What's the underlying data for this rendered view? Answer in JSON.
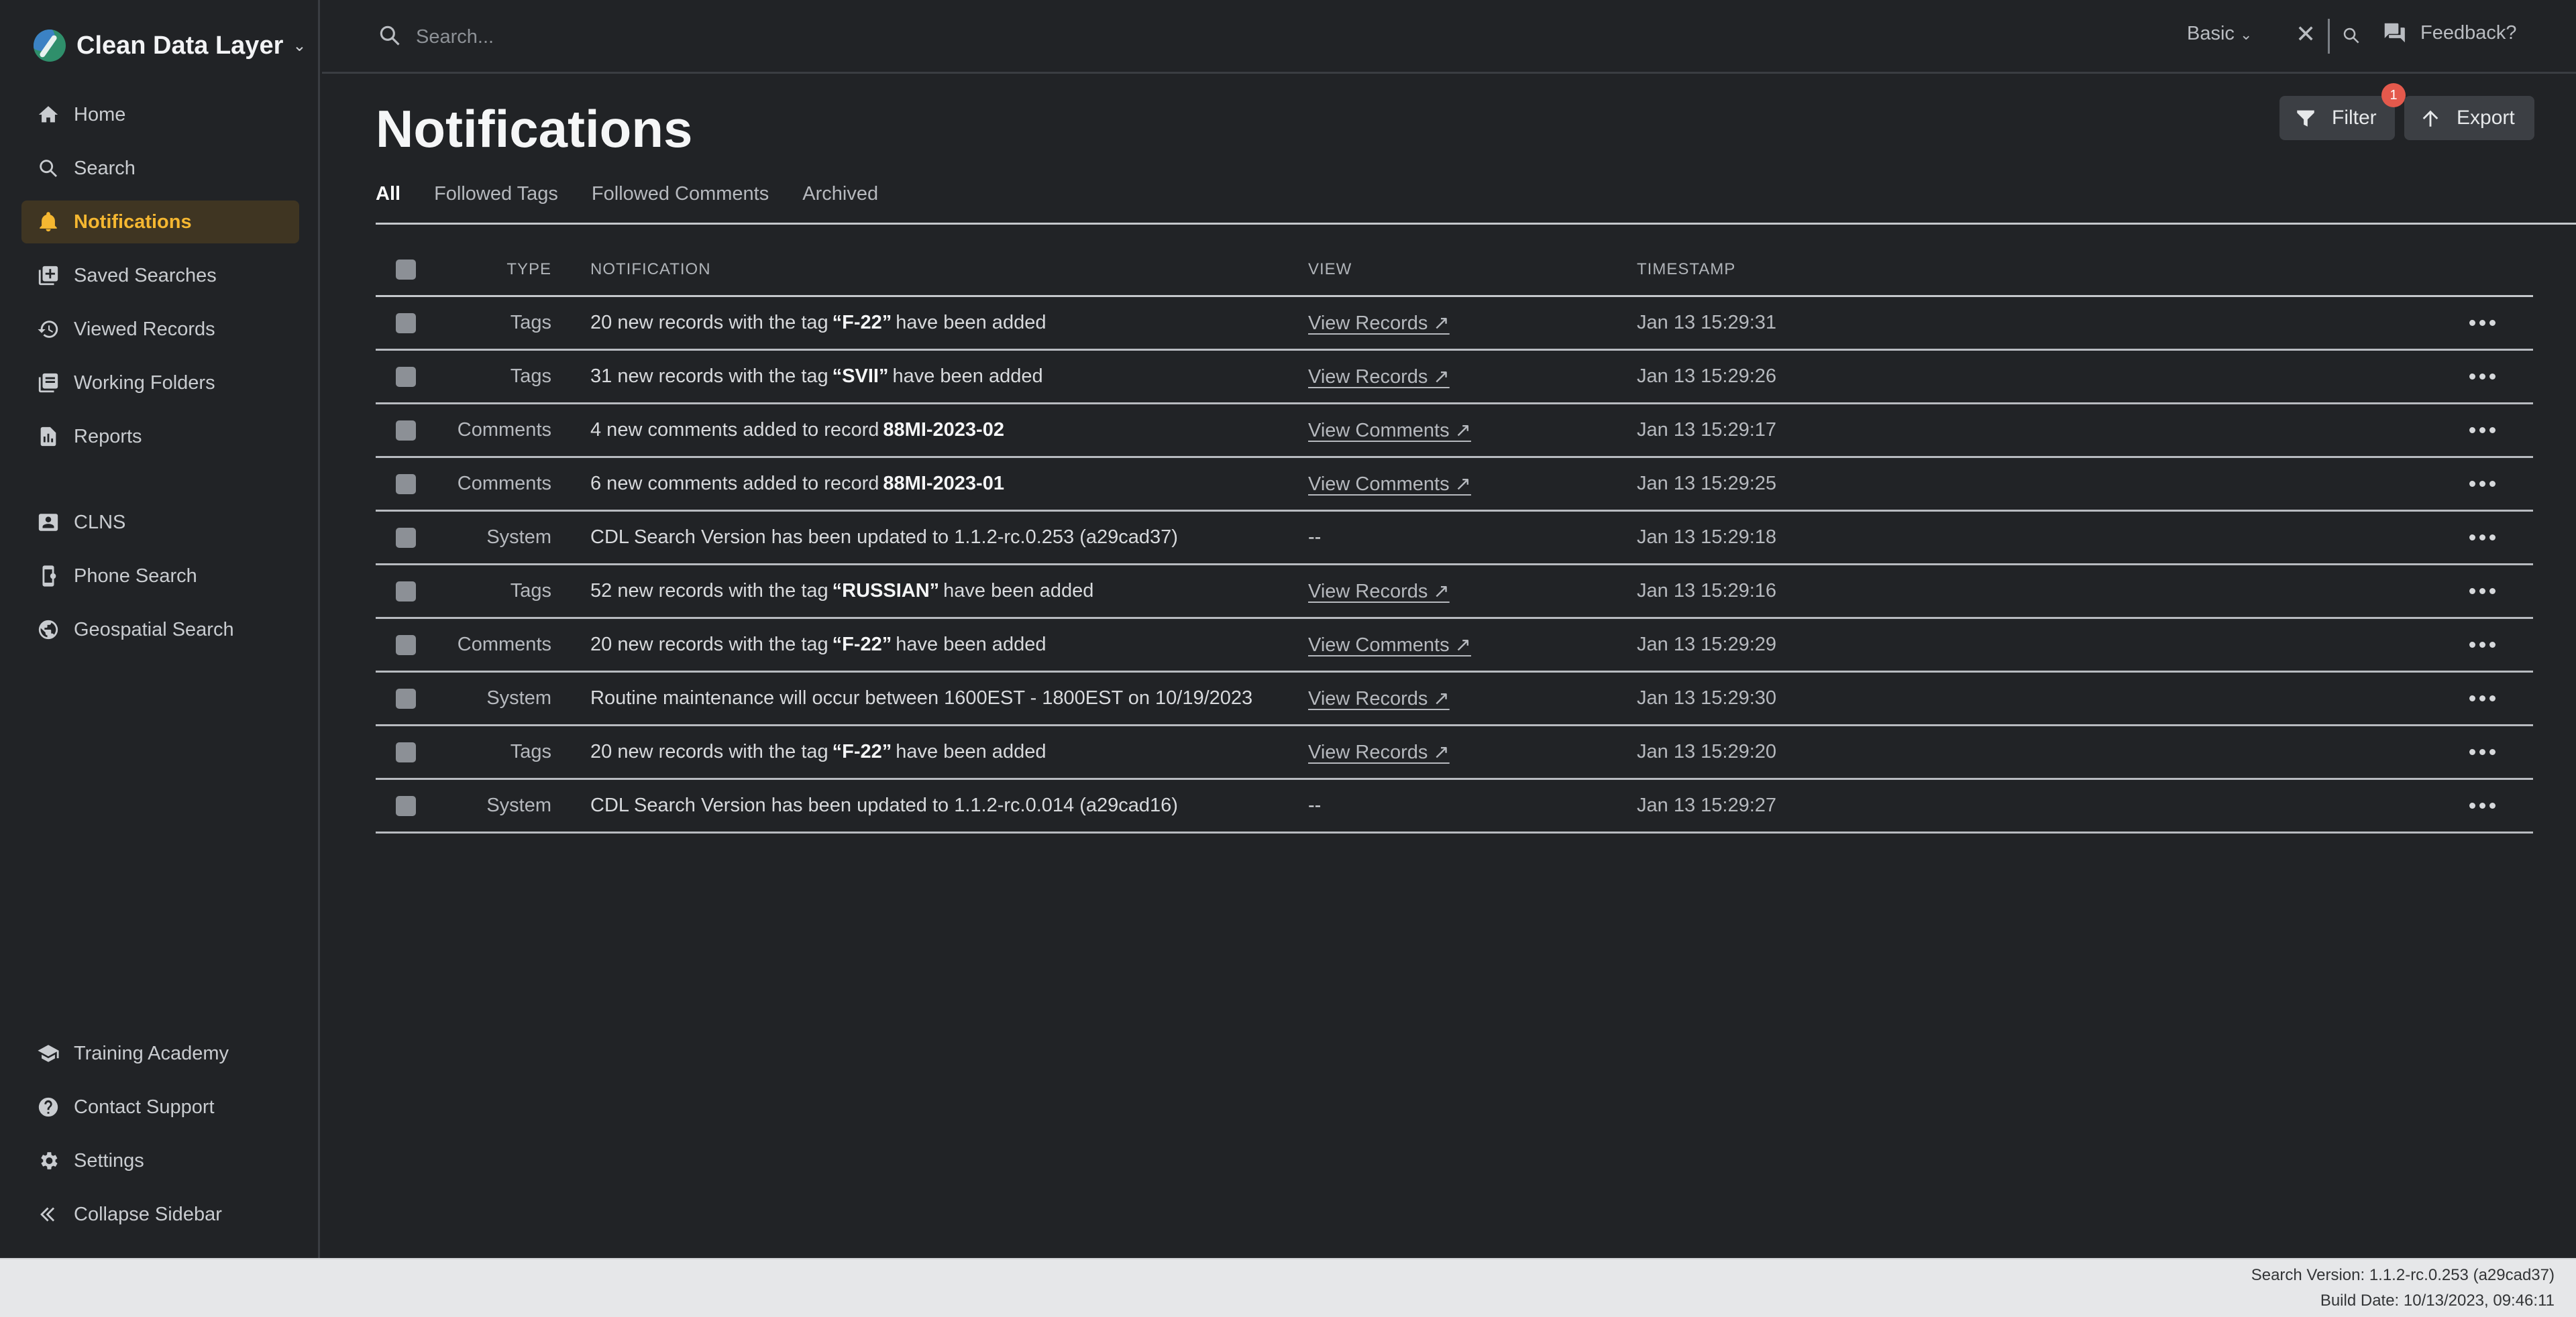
{
  "app": {
    "name": "Clean Data Layer"
  },
  "sidebar": {
    "items": [
      {
        "label": "Home",
        "icon": "home-icon"
      },
      {
        "label": "Search",
        "icon": "search-icon"
      },
      {
        "label": "Notifications",
        "icon": "bell-icon",
        "active": true
      },
      {
        "label": "Saved Searches",
        "icon": "saved-search-icon"
      },
      {
        "label": "Viewed Records",
        "icon": "history-icon"
      },
      {
        "label": "Working Folders",
        "icon": "folder-icon"
      },
      {
        "label": "Reports",
        "icon": "report-icon"
      },
      {
        "label": "CLNS",
        "icon": "contact-card-icon"
      },
      {
        "label": "Phone Search",
        "icon": "phone-icon"
      },
      {
        "label": "Geospatial Search",
        "icon": "globe-icon"
      }
    ],
    "bottom_items": [
      {
        "label": "Training Academy",
        "icon": "graduation-cap-icon"
      },
      {
        "label": "Contact Support",
        "icon": "help-icon"
      },
      {
        "label": "Settings",
        "icon": "gear-icon"
      },
      {
        "label": "Collapse Sidebar",
        "icon": "double-chevron-left-icon"
      }
    ]
  },
  "topbar": {
    "search_placeholder": "Search...",
    "mode": "Basic",
    "feedback": "Feedback?"
  },
  "page": {
    "title": "Notifications",
    "filter_label": "Filter",
    "filter_count": "1",
    "export_label": "Export",
    "tabs": [
      "All",
      "Followed Tags",
      "Followed Comments",
      "Archived"
    ],
    "active_tab": "All"
  },
  "table": {
    "headers": {
      "type": "Type",
      "notification": "Notification",
      "view": "View",
      "timestamp": "Timestamp"
    },
    "rows": [
      {
        "type": "Tags",
        "pre": "20 new records with the tag",
        "bold": "“F-22”",
        "post": "have been added",
        "view": "View Records ↗",
        "time": "Jan 13 15:29:31"
      },
      {
        "type": "Tags",
        "pre": "31 new records with the tag",
        "bold": "“SVII”",
        "post": "have been added",
        "view": "View Records ↗",
        "time": "Jan 13 15:29:26"
      },
      {
        "type": "Comments",
        "pre": "4 new comments added to record",
        "bold": "88MI-2023-02",
        "post": "",
        "view": "View Comments ↗",
        "time": "Jan 13 15:29:17"
      },
      {
        "type": "Comments",
        "pre": "6 new comments added to record",
        "bold": "88MI-2023-01",
        "post": "",
        "view": "View Comments ↗",
        "time": "Jan 13 15:29:25"
      },
      {
        "type": "System",
        "pre": "CDL Search Version has been updated to 1.1.2-rc.0.253 (a29cad37)",
        "bold": "",
        "post": "",
        "view": "--",
        "time": "Jan 13 15:29:18"
      },
      {
        "type": "Tags",
        "pre": "52 new records with the tag",
        "bold": "“RUSSIAN”",
        "post": "have been added",
        "view": "View Records ↗",
        "time": "Jan 13 15:29:16"
      },
      {
        "type": "Comments",
        "pre": "20 new records with the tag",
        "bold": "“F-22”",
        "post": "have been added",
        "view": "View Comments ↗",
        "time": "Jan 13 15:29:29"
      },
      {
        "type": "System",
        "pre": "Routine maintenance will occur between 1600EST - 1800EST on 10/19/2023",
        "bold": "",
        "post": "",
        "view": "View Records ↗",
        "time": "Jan 13 15:29:30"
      },
      {
        "type": "Tags",
        "pre": "20 new records with the tag",
        "bold": "“F-22”",
        "post": "have been added",
        "view": "View Records ↗",
        "time": "Jan 13 15:29:20"
      },
      {
        "type": "System",
        "pre": "CDL Search Version has been updated to 1.1.2-rc.0.014 (a29cad16)",
        "bold": "",
        "post": "",
        "view": "--",
        "time": "Jan 13 15:29:27"
      }
    ]
  },
  "footer": {
    "search_version": "Search Version: 1.1.2-rc.0.253 (a29cad37)",
    "build_date": "Build Date: 10/13/2023, 09:46:11"
  },
  "colors": {
    "accent": "#f5b731",
    "badge": "#e4594c",
    "background": "#212326"
  }
}
